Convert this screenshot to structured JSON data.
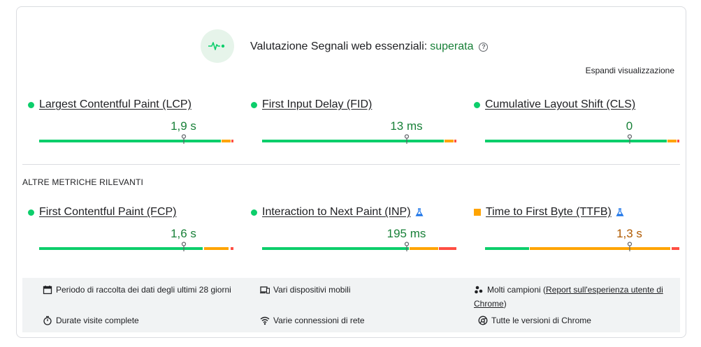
{
  "header": {
    "title": "Valutazione Segnali web essenziali:",
    "status": "superata",
    "help_icon": "help-icon",
    "status_icon": "pulse-icon",
    "expand_label": "Espandi visualizzazione"
  },
  "core_metrics": [
    {
      "name": "Largest Contentful Paint (LCP)",
      "value": "1,9 s",
      "status": "good",
      "experimental": false,
      "marker_fraction": 0.75
    },
    {
      "name": "First Input Delay (FID)",
      "value": "13 ms",
      "status": "good",
      "experimental": false,
      "marker_fraction": 0.75
    },
    {
      "name": "Cumulative Layout Shift (CLS)",
      "value": "0",
      "status": "good",
      "experimental": false,
      "marker_fraction": 0.75
    }
  ],
  "other_section_label": "ALTRE METRICHE RILEVANTI",
  "other_metrics": [
    {
      "name": "First Contentful Paint (FCP)",
      "value": "1,6 s",
      "status": "good",
      "experimental": false,
      "marker_fraction": 0.75
    },
    {
      "name": "Interaction to Next Paint (INP)",
      "value": "195 ms",
      "status": "good",
      "experimental": true,
      "marker_fraction": 0.75
    },
    {
      "name": "Time to First Byte (TTFB)",
      "value": "1,3 s",
      "status": "average",
      "experimental": true,
      "marker_fraction": 0.75
    }
  ],
  "footer": {
    "period": "Periodo di raccolta dei dati degli ultimi 28 giorni",
    "devices": "Vari dispositivi mobili",
    "samples_prefix": "Molti campioni (",
    "samples_link": "Report sull'esperienza utente di Chrome",
    "samples_suffix": ")",
    "durations": "Durate visite complete",
    "connections": "Varie connessioni di rete",
    "versions": "Tutte le versioni di Chrome"
  },
  "colors": {
    "good": "#0cce6b",
    "average": "#ffa400",
    "poor": "#ff4e42",
    "pass_text": "#188038"
  }
}
